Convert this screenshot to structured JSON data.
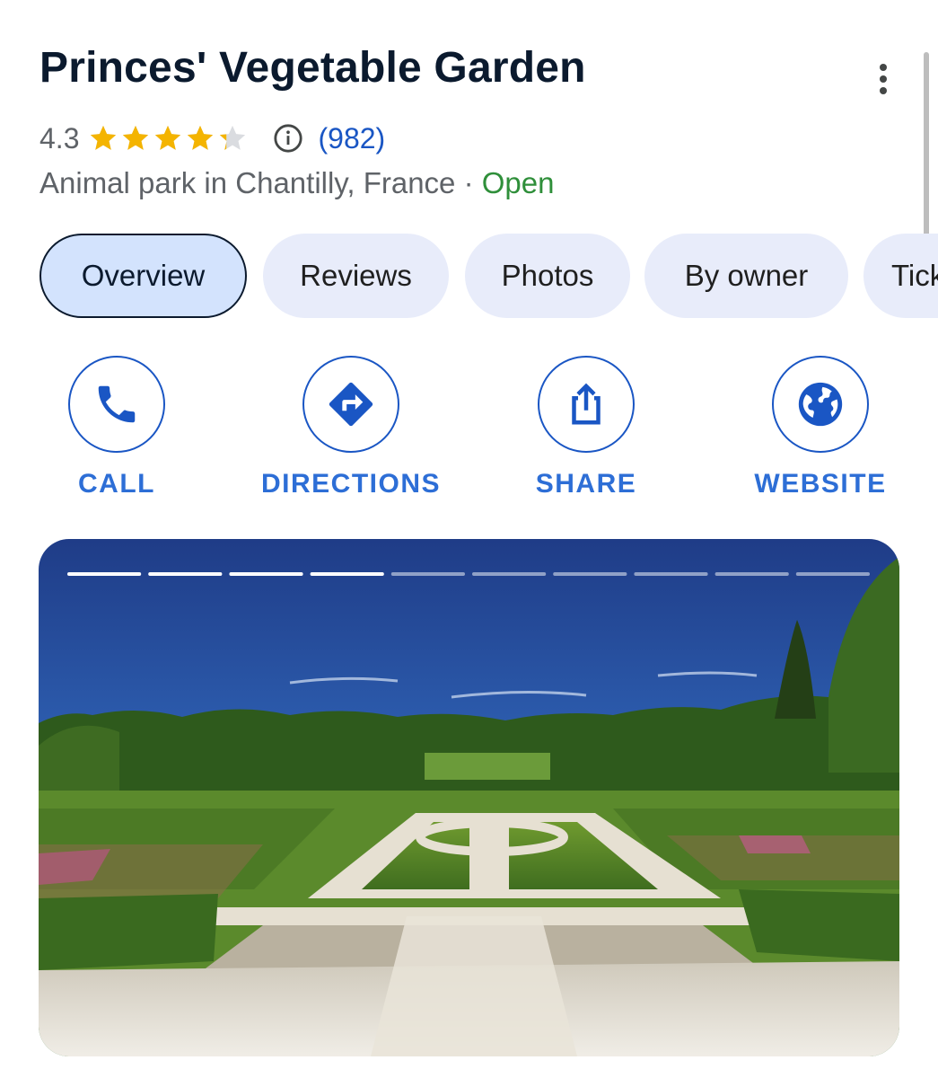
{
  "place": {
    "title": "Princes' Vegetable Garden",
    "rating": "4.3",
    "rating_value": 4.3,
    "stars_max": 5,
    "review_count": "(982)",
    "category": "Animal park in Chantilly, France",
    "separator": " · ",
    "status": "Open"
  },
  "tabs": [
    {
      "label": "Overview",
      "active": true
    },
    {
      "label": "Reviews",
      "active": false
    },
    {
      "label": "Photos",
      "active": false
    },
    {
      "label": "By owner",
      "active": false
    },
    {
      "label": "Tickets",
      "active": false
    }
  ],
  "actions": [
    {
      "label": "CALL",
      "icon": "phone-icon"
    },
    {
      "label": "DIRECTIONS",
      "icon": "directions-icon"
    },
    {
      "label": "SHARE",
      "icon": "share-icon"
    },
    {
      "label": "WEBSITE",
      "icon": "globe-icon"
    }
  ],
  "photo_carousel": {
    "total_slides": 10,
    "viewed_slides": 4,
    "subject": "formal garden parterre with vegetable beds under a blue sky"
  },
  "colors": {
    "accent": "#1a56c4",
    "action_label": "#2d6ed6",
    "open_status": "#2f8f3a",
    "star": "#f4b400",
    "tab_bg": "#e8ecfa",
    "tab_active_bg": "#d3e3fd"
  }
}
